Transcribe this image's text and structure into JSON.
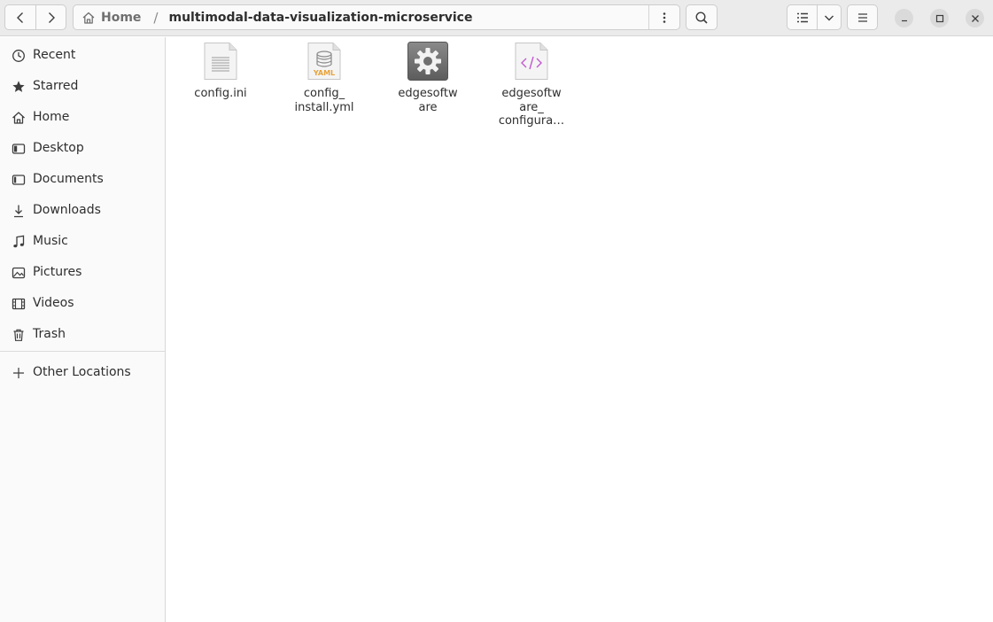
{
  "header": {
    "breadcrumb_home": "Home",
    "breadcrumb_separator": "/",
    "breadcrumb_current": "multimodal-data-visualization-microservice"
  },
  "sidebar": {
    "items": [
      {
        "label": "Recent",
        "icon": "clock-icon"
      },
      {
        "label": "Starred",
        "icon": "star-icon"
      },
      {
        "label": "Home",
        "icon": "home-icon"
      },
      {
        "label": "Desktop",
        "icon": "desktop-icon"
      },
      {
        "label": "Documents",
        "icon": "documents-icon"
      },
      {
        "label": "Downloads",
        "icon": "download-icon"
      },
      {
        "label": "Music",
        "icon": "music-icon"
      },
      {
        "label": "Pictures",
        "icon": "pictures-icon"
      },
      {
        "label": "Videos",
        "icon": "videos-icon"
      },
      {
        "label": "Trash",
        "icon": "trash-icon"
      }
    ],
    "other_locations": "Other Locations"
  },
  "files": [
    {
      "name": "config.ini",
      "icon": "text-file-icon"
    },
    {
      "name": "config_\ninstall.yml",
      "icon": "yaml-file-icon"
    },
    {
      "name": "edgesoftw\nare",
      "icon": "executable-gear-icon"
    },
    {
      "name": "edgesoftw\nare_\nconfigura…",
      "icon": "xml-file-icon"
    }
  ],
  "colors": {
    "headerbar": "#ebebeb",
    "sidebar": "#fafafa",
    "xml_accent": "#c25ad1",
    "yaml_accent": "#e8a23a"
  }
}
